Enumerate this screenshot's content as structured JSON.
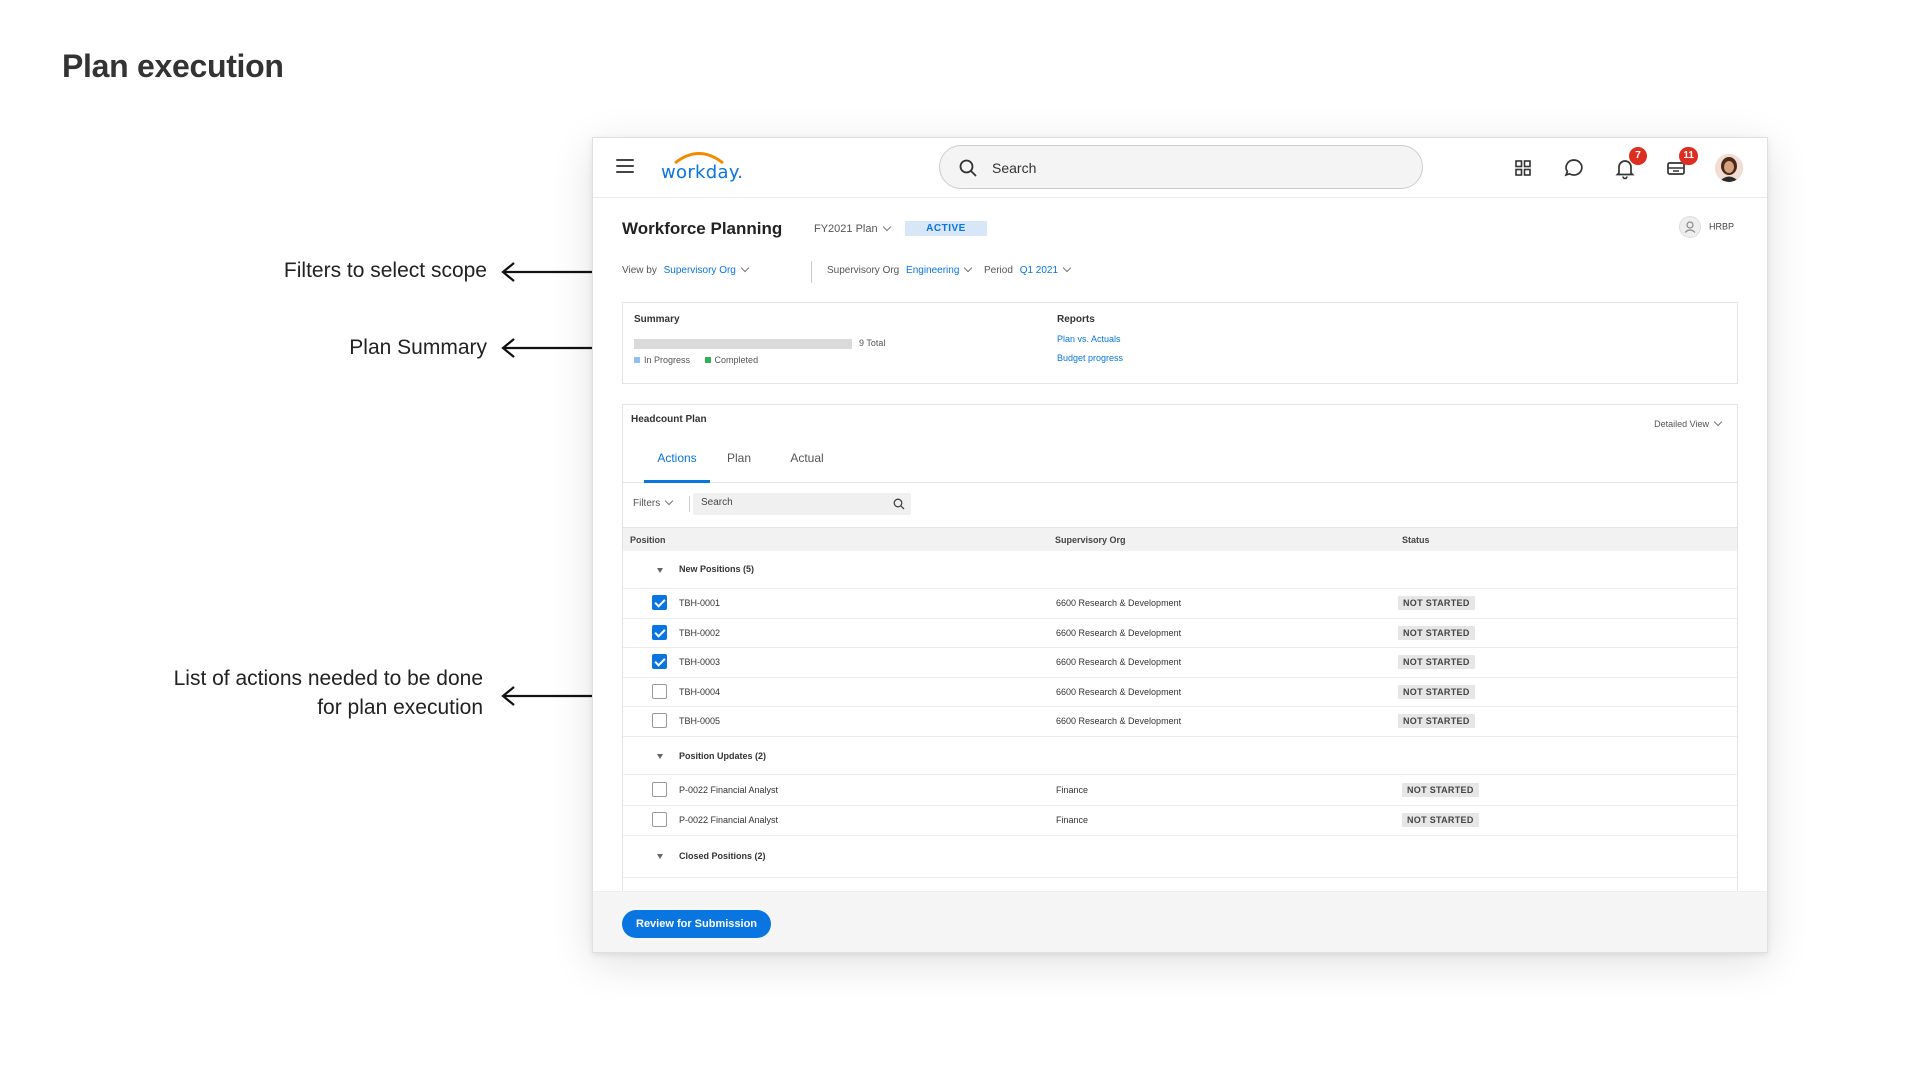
{
  "slide": {
    "title": "Plan execution",
    "annotations": [
      {
        "lines": [
          "Filters to select scope"
        ]
      },
      {
        "lines": [
          "Plan Summary"
        ]
      },
      {
        "lines": [
          "List of actions needed to be done",
          "for plan execution"
        ]
      }
    ]
  },
  "topbar": {
    "logo_text": "workday.",
    "search_placeholder": "Search",
    "notifications_count": "7",
    "inbox_count": "11"
  },
  "header": {
    "title": "Workforce Planning",
    "plan_select": "FY2021 Plan",
    "status": "ACTIVE",
    "role": "HRBP"
  },
  "filters": {
    "view_by_label": "View by",
    "view_by_value": "Supervisory Org",
    "org_label": "Supervisory Org",
    "org_value": "Engineering",
    "period_label": "Period",
    "period_value": "Q1 2021"
  },
  "summary": {
    "title": "Summary",
    "total_text": "9 Total",
    "progress_fraction": 0,
    "legend_in_progress": "In Progress",
    "legend_completed": "Completed",
    "reports_title": "Reports",
    "reports": [
      "Plan vs. Actuals",
      "Budget progress"
    ],
    "colors": {
      "in_progress": "#5aa3e8",
      "completed": "#2eb35a",
      "track": "#dadada"
    }
  },
  "headcount": {
    "title": "Headcount Plan",
    "view_select": "Detailed View",
    "tabs": [
      "Actions",
      "Plan",
      "Actual"
    ],
    "active_tab": "Actions",
    "filters_label": "Filters",
    "search_placeholder": "Search",
    "columns": [
      "Position",
      "Supervisory Org",
      "Status"
    ],
    "groups": [
      {
        "label": "New Positions (5)",
        "rows": [
          {
            "position": "TBH-0001",
            "org": "6600 Research & Development",
            "status": "NOT STARTED",
            "checked": true
          },
          {
            "position": "TBH-0002",
            "org": "6600 Research & Development",
            "status": "NOT STARTED",
            "checked": true
          },
          {
            "position": "TBH-0003",
            "org": "6600 Research & Development",
            "status": "NOT STARTED",
            "checked": true
          },
          {
            "position": "TBH-0004",
            "org": "6600 Research & Development",
            "status": "NOT STARTED",
            "checked": false
          },
          {
            "position": "TBH-0005",
            "org": "6600 Research & Development",
            "status": "NOT STARTED",
            "checked": false
          }
        ]
      },
      {
        "label": "Position Updates (2)",
        "rows": [
          {
            "position": "P-0022 Financial Analyst",
            "org": "Finance",
            "status": "NOT STARTED",
            "checked": false
          },
          {
            "position": "P-0022 Financial Analyst",
            "org": "Finance",
            "status": "NOT STARTED",
            "checked": false
          }
        ]
      },
      {
        "label": "Closed Positions (2)",
        "rows": []
      }
    ]
  },
  "footer": {
    "primary_action": "Review for Submission"
  },
  "colors": {
    "accent": "#0875e1",
    "badge": "#de2e21"
  }
}
